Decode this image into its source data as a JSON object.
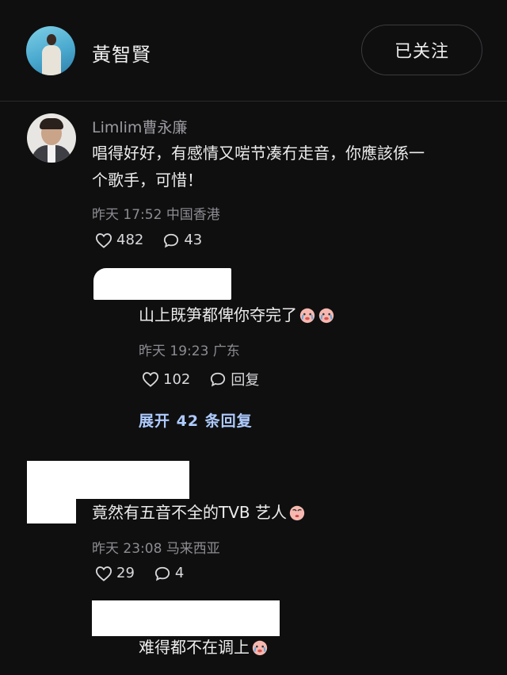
{
  "header": {
    "name": "黃智賢",
    "follow_label": "已关注"
  },
  "comments": [
    {
      "username": "Limlim曹永廉",
      "text_line1": "唱得好好，有感情又啱节凑冇走音，你應該係一",
      "text_line2": "个歌手，可惜！",
      "time": "昨天 17:52",
      "location": "中国香港",
      "likes": "482",
      "replies": "43"
    },
    {
      "text": "山上既笋都俾你夺完了",
      "time": "昨天 19:23",
      "location": "广东",
      "likes": "102",
      "reply_label": "回复"
    },
    {
      "text": "竟然有五音不全的TVB 艺人",
      "time": "昨天 23:08",
      "location": "马来西亚",
      "likes": "29",
      "replies": "4"
    },
    {
      "text": "难得都不在调上",
      "time": "",
      "location": ""
    }
  ],
  "expand_label": "展开 42 条回复",
  "icons": {
    "like": "heart-outline-icon",
    "comment": "speech-bubble-icon",
    "emoji": "crying-face-emoji"
  },
  "colors": {
    "background": "#0f0f10",
    "link": "#aecbff"
  }
}
